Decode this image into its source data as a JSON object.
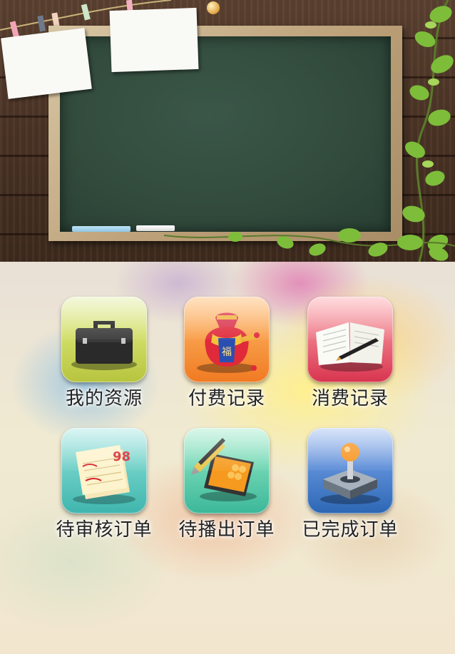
{
  "menu": {
    "items": [
      {
        "label": "我的资源",
        "icon": "briefcase-icon",
        "color": "#b7c43e"
      },
      {
        "label": "付费记录",
        "icon": "money-bag-icon",
        "color": "#f07a22"
      },
      {
        "label": "消费记录",
        "icon": "open-book-icon",
        "color": "#d8344e"
      },
      {
        "label": "待审核订单",
        "icon": "graded-papers-icon",
        "color": "#3fb5ad"
      },
      {
        "label": "待播出订单",
        "icon": "pencil-notebook-icon",
        "color": "#3cb79a"
      },
      {
        "label": "已完成订单",
        "icon": "joystick-icon",
        "color": "#2c67b4"
      }
    ]
  },
  "notes": {
    "score": "98"
  }
}
